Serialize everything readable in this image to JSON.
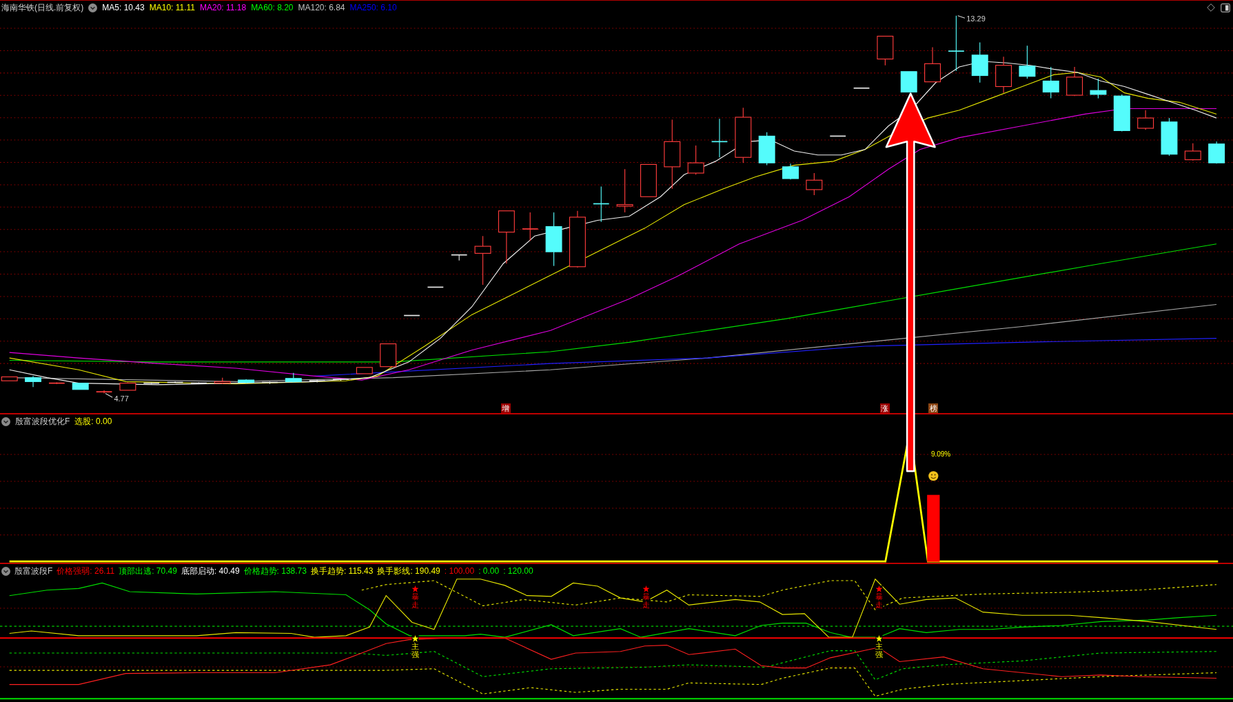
{
  "main_panel": {
    "title": "海南华铁(日线.前复权)",
    "indicators": [
      {
        "label": "MA5: 10.43",
        "color": "#ffffff"
      },
      {
        "label": "MA10: 11.11",
        "color": "#ffff00"
      },
      {
        "label": "MA20: 11.18",
        "color": "#ff00ff"
      },
      {
        "label": "MA60: 8.20",
        "color": "#00ff00"
      },
      {
        "label": "MA120: 6.84",
        "color": "#c0c0c0"
      },
      {
        "label": "MA250: 6.10",
        "color": "#0000ff"
      }
    ],
    "high_label": "13.29",
    "low_label": "4.77",
    "signal_tags": [
      {
        "text": "增",
        "color": "#9a0000"
      },
      {
        "text": "涨",
        "color": "#9a0000"
      },
      {
        "text": "榜",
        "color": "#8b4513"
      }
    ]
  },
  "middle_panel": {
    "title": "殷富波段优化F",
    "indicators": [
      {
        "label": "选股: 0.00",
        "color": "#ffff00"
      }
    ],
    "reading": "9.09%"
  },
  "bottom_panel": {
    "title": "殷富波段F",
    "indicators": [
      {
        "label": "价格强弱: 26.11",
        "color": "#ff0000"
      },
      {
        "label": "顶部出逃: 70.49",
        "color": "#00ff00"
      },
      {
        "label": "底部启动: 40.49",
        "color": "#ffffff"
      },
      {
        "label": "价格趋势: 138.73",
        "color": "#00ff00"
      },
      {
        "label": "换手趋势: 115.43",
        "color": "#ffff00"
      },
      {
        "label": "换手影线: 190.49",
        "color": "#ffff00"
      },
      {
        "label": ": 100.00",
        "color": "#ff0000"
      },
      {
        "label": ": 0.00",
        "color": "#00ff00"
      },
      {
        "label": ": 120.00",
        "color": "#00ff00"
      }
    ],
    "markers": [
      {
        "text": "暴走",
        "color": "#ff0000"
      },
      {
        "text": "暴走",
        "color": "#ff0000"
      },
      {
        "text": "暴走",
        "color": "#ff0000"
      },
      {
        "text": "主强",
        "color": "#ffff00"
      },
      {
        "text": "主强",
        "color": "#ffff00"
      }
    ]
  }
}
